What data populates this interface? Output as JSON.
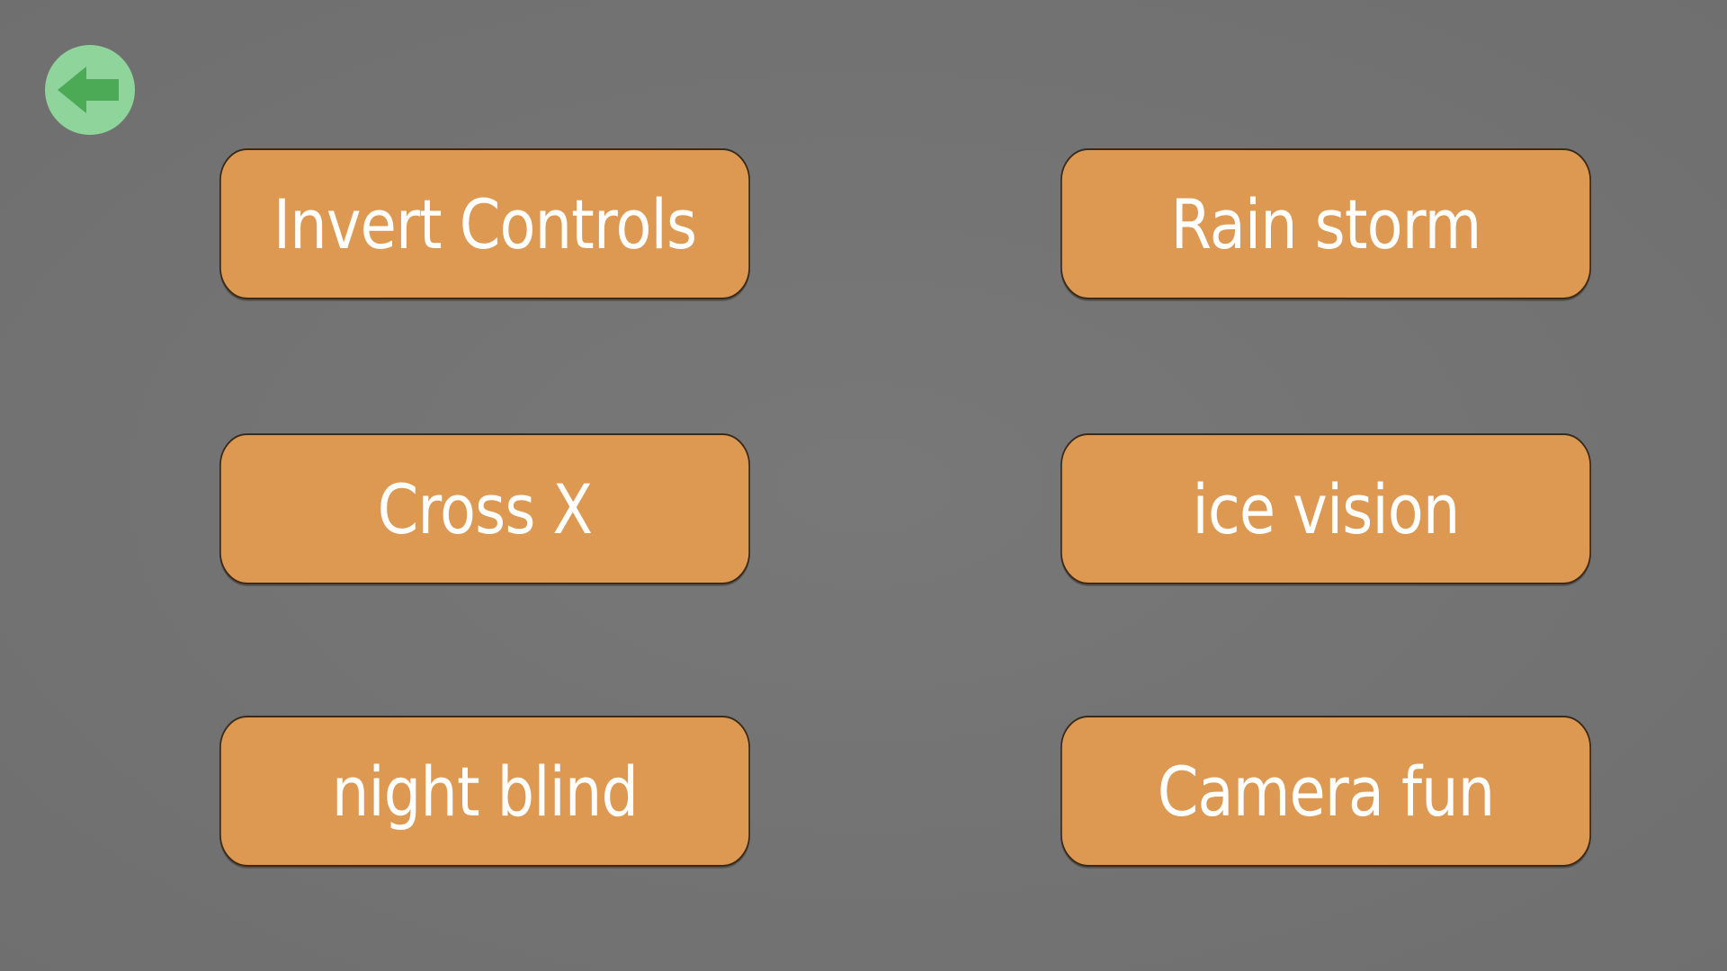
{
  "back": {
    "icon": "arrow-left-icon",
    "bg_color": "#8fd49a",
    "arrow_color": "#4caa57"
  },
  "options": [
    {
      "label": "Invert Controls"
    },
    {
      "label": "Rain storm"
    },
    {
      "label": "Cross X"
    },
    {
      "label": "ice vision"
    },
    {
      "label": "night blind"
    },
    {
      "label": "Camera fun"
    }
  ],
  "colors": {
    "background": "#737373",
    "button": "#dd9951",
    "button_border": "#3a2a1a",
    "button_text": "#ffffff"
  }
}
